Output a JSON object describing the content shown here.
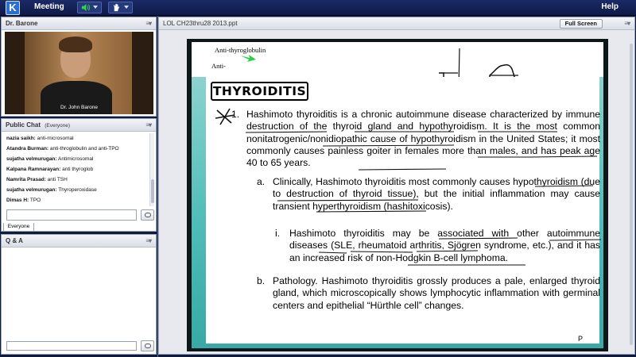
{
  "topbar": {
    "logo": "K",
    "menu_meeting": "Meeting",
    "help": "Help",
    "icons": [
      "speaker-icon",
      "raise-hand-icon"
    ]
  },
  "video_pod": {
    "title": "Dr. Barone",
    "presenter_name": "Dr. John Barone"
  },
  "chat_pod": {
    "title": "Public Chat",
    "audience": "(Everyone)",
    "messages": [
      {
        "user": "nazia saikh:",
        "text": " anti-microsomal"
      },
      {
        "user": "Atandra Burman:",
        "text": " anti-throglobulin and anti-TPO"
      },
      {
        "user": "sujatha velmurugan:",
        "text": " Antimicrosomal"
      },
      {
        "user": "Kalpana Ramnarayan:",
        "text": " anti thyroglob"
      },
      {
        "user": "Namrita Prasad:",
        "text": " anti TSH"
      },
      {
        "user": "sujatha velmurugan:",
        "text": " Thyroperoxidase"
      },
      {
        "user": "Dimas H:",
        "text": " TPO"
      }
    ],
    "tab": "Everyone"
  },
  "qa_pod": {
    "title": "Q & A"
  },
  "share_pod": {
    "title": "LOL CH23thru28 2013.ppt",
    "full_screen_label": "Full Screen"
  },
  "slide": {
    "handwriting_1": "Anti-thyroglobulin",
    "handwriting_2": "Anti-",
    "title": "THYROIDITIS",
    "num_1": "1.",
    "item_1": "Hashimoto thyroiditis is a chronic autoimmune disease characterized by immune destruction of the thyroid gland and hypothyroidism. It is the most common nonitatrogenic/nonidiopathic cause of hypothyroidism in the United States; it most commonly causes painless goiter in females more than males, and has peak age 40 to 65 years.",
    "label_a": "a.",
    "item_a": "Clinically, Hashimoto thyroiditis most commonly causes hypothyroidism (due to destruction of thyroid tissue), but the initial inflammation may cause transient hyperthyroidism (hashitoxicosis).",
    "label_i": "i.",
    "item_i": "Hashimoto thyroiditis may be associated with other autoimmune diseases (SLE, rheumatoid arthritis, Sjögren syndrome, etc.), and it has an increased risk of non-Hodgkin B-cell lymphoma.",
    "label_b": "b.",
    "item_b": "Pathology. Hashimoto thyroiditis grossly produces a pale, enlarged thyroid gland, which microscopically shows lymphocytic inflammation with germinal centers and epithelial “Hürthle cell” changes.",
    "page_mark": "P"
  }
}
